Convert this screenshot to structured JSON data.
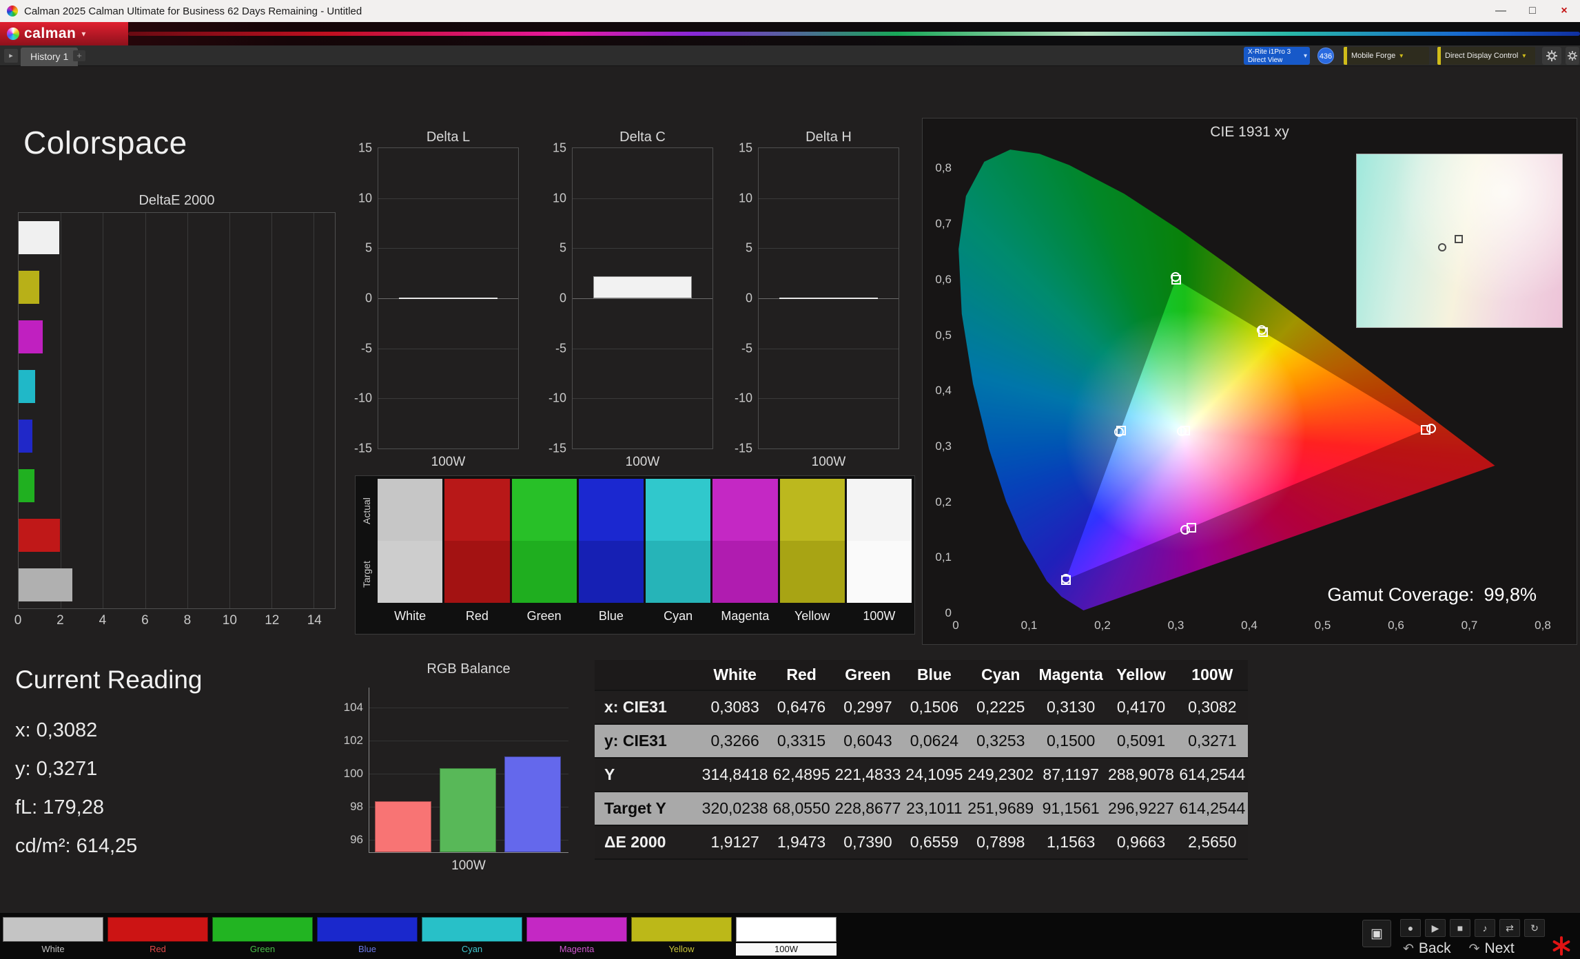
{
  "window": {
    "title": "Calman 2025 Calman Ultimate for Business 62 Days Remaining  - Untitled",
    "minimize_label": "—",
    "maximize_label": "□",
    "close_label": "×"
  },
  "brand": {
    "name": "calman"
  },
  "icons": {
    "caret_down": "▾",
    "caret_right": "▸"
  },
  "tabs": {
    "history_label": "History 1",
    "add_label": "+"
  },
  "devices": {
    "meter_line1": "X-Rite i1Pro 3",
    "meter_line2": "Direct View",
    "badge": "436",
    "pattern_source": "Mobile Forge",
    "display_control": "Direct Display Control"
  },
  "page": {
    "title": "Colorspace"
  },
  "deltae": {
    "title": "DeltaE 2000",
    "xmax": 15,
    "xticks": [
      0,
      2,
      4,
      6,
      8,
      10,
      12,
      14
    ],
    "bars": [
      {
        "name": "White",
        "color": "#f0f0f0",
        "value": 1.9127
      },
      {
        "name": "Yellow",
        "color": "#b8b018",
        "value": 0.9663
      },
      {
        "name": "Magenta",
        "color": "#c020c0",
        "value": 1.1563
      },
      {
        "name": "Cyan",
        "color": "#20b8c8",
        "value": 0.7898
      },
      {
        "name": "Blue",
        "color": "#2028c8",
        "value": 0.6559
      },
      {
        "name": "Green",
        "color": "#20b020",
        "value": 0.739
      },
      {
        "name": "Red",
        "color": "#c01818",
        "value": 1.9473
      },
      {
        "name": "100W",
        "color": "#b0b0b0",
        "value": 2.565
      }
    ]
  },
  "delta_range": 15,
  "delta_yticks": [
    15,
    10,
    5,
    0,
    -5,
    -10,
    -15
  ],
  "delta_charts": [
    {
      "title": "Delta L",
      "value": 0,
      "label": "100W"
    },
    {
      "title": "Delta C",
      "value": 2.2,
      "label": "100W"
    },
    {
      "title": "Delta H",
      "value": 0,
      "label": "100W"
    }
  ],
  "swatch_strip": {
    "row_labels": [
      "Actual",
      "Target"
    ],
    "patches": [
      {
        "name": "White",
        "actual": "#c6c6c6",
        "target": "#cdcdcd"
      },
      {
        "name": "Red",
        "actual": "#b81818",
        "target": "#a31212"
      },
      {
        "name": "Green",
        "actual": "#28c028",
        "target": "#1fae1f"
      },
      {
        "name": "Blue",
        "actual": "#1b28d0",
        "target": "#1620b4"
      },
      {
        "name": "Cyan",
        "actual": "#30c8cc",
        "target": "#26b4b8"
      },
      {
        "name": "Magenta",
        "actual": "#c428c4",
        "target": "#b01cb0"
      },
      {
        "name": "Yellow",
        "actual": "#bcb81e",
        "target": "#a8a414"
      },
      {
        "name": "100W",
        "actual": "#f4f4f4",
        "target": "#fafafa"
      }
    ]
  },
  "cie": {
    "title": "CIE 1931 xy",
    "xticks": [
      "0",
      "0,1",
      "0,2",
      "0,3",
      "0,4",
      "0,5",
      "0,6",
      "0,7",
      "0,8"
    ],
    "yticks": [
      "0",
      "0,1",
      "0,2",
      "0,3",
      "0,4",
      "0,5",
      "0,6",
      "0,7",
      "0,8"
    ],
    "xmax": 0.8,
    "ymax": 0.86,
    "gamut_label": "Gamut Coverage:",
    "gamut_value": "99,8%",
    "triangle": [
      [
        0.64,
        0.33
      ],
      [
        0.3,
        0.6
      ],
      [
        0.15,
        0.06
      ]
    ],
    "measured": [
      [
        0.3083,
        0.3266
      ],
      [
        0.6476,
        0.3315
      ],
      [
        0.2997,
        0.6043
      ],
      [
        0.1506,
        0.0624
      ],
      [
        0.2225,
        0.3253
      ],
      [
        0.313,
        0.15
      ],
      [
        0.417,
        0.5091
      ]
    ],
    "target": [
      [
        0.3127,
        0.329
      ],
      [
        0.64,
        0.33
      ],
      [
        0.3,
        0.6
      ],
      [
        0.15,
        0.06
      ],
      [
        0.225,
        0.329
      ],
      [
        0.321,
        0.154
      ],
      [
        0.419,
        0.505
      ]
    ],
    "inset_measured": [
      41.5,
      53.8
    ],
    "inset_target": [
      49.8,
      49.1
    ]
  },
  "current_reading": {
    "title": "Current Reading",
    "lines": [
      "x: 0,3082",
      "y: 0,3271",
      "fL: 179,28",
      "cd/m²: 614,25"
    ]
  },
  "rgb_balance": {
    "title": "RGB Balance",
    "label": "100W",
    "ymin": 95.2,
    "ymax": 105.2,
    "yticks": [
      104,
      102,
      100,
      98,
      96
    ],
    "bars": [
      {
        "name": "red",
        "color": "#f87474",
        "value": 98.3
      },
      {
        "name": "green",
        "color": "#58b858",
        "value": 100.3
      },
      {
        "name": "blue",
        "color": "#6468ec",
        "value": 101.0
      }
    ]
  },
  "table": {
    "columns": [
      "",
      "White",
      "Red",
      "Green",
      "Blue",
      "Cyan",
      "Magenta",
      "Yellow",
      "100W"
    ],
    "rows": [
      {
        "label": "x: CIE31",
        "light": false,
        "values": [
          "0,3083",
          "0,6476",
          "0,2997",
          "0,1506",
          "0,2225",
          "0,3130",
          "0,4170",
          "0,3082"
        ]
      },
      {
        "label": "y: CIE31",
        "light": true,
        "values": [
          "0,3266",
          "0,3315",
          "0,6043",
          "0,0624",
          "0,3253",
          "0,1500",
          "0,5091",
          "0,3271"
        ]
      },
      {
        "label": "Y",
        "light": false,
        "values": [
          "314,8418",
          "62,4895",
          "221,4833",
          "24,1095",
          "249,2302",
          "87,1197",
          "288,9078",
          "614,2544"
        ]
      },
      {
        "label": "Target Y",
        "light": true,
        "values": [
          "320,0238",
          "68,0550",
          "228,8677",
          "23,1011",
          "251,9689",
          "91,1561",
          "296,9227",
          "614,2544"
        ]
      },
      {
        "label": "ΔE 2000",
        "light": false,
        "values": [
          "1,9127",
          "1,9473",
          "0,7390",
          "0,6559",
          "0,7898",
          "1,1563",
          "0,9663",
          "2,5650"
        ]
      }
    ]
  },
  "bottom": {
    "swatches": [
      {
        "label": "White",
        "color": "#c4c4c4",
        "text": "#c0c0c0",
        "selected": false
      },
      {
        "label": "Red",
        "color": "#cc1414",
        "text": "#e04848",
        "selected": false
      },
      {
        "label": "Green",
        "color": "#22b422",
        "text": "#48c048",
        "selected": false
      },
      {
        "label": "Blue",
        "color": "#1a28cc",
        "text": "#6a78e8",
        "selected": false
      },
      {
        "label": "Cyan",
        "color": "#28c0c8",
        "text": "#40c8d0",
        "selected": false
      },
      {
        "label": "Magenta",
        "color": "#c428c4",
        "text": "#d058d0",
        "selected": false
      },
      {
        "label": "Yellow",
        "color": "#bcb818",
        "text": "#c8c438",
        "selected": false
      },
      {
        "label": "100W",
        "color": "#ffffff",
        "text": "#111111",
        "selected": true
      }
    ],
    "display_glyph": "▣",
    "transport": [
      {
        "name": "record-icon",
        "glyph": "●"
      },
      {
        "name": "play-icon",
        "glyph": "▶"
      },
      {
        "name": "stop-icon",
        "glyph": "■"
      },
      {
        "name": "audio-icon",
        "glyph": "♪"
      },
      {
        "name": "loop-icon",
        "glyph": "⇄"
      },
      {
        "name": "refresh-icon",
        "glyph": "↻"
      }
    ],
    "back_icon": "↶",
    "back_label": "Back",
    "next_icon": "↷",
    "next_label": "Next"
  }
}
